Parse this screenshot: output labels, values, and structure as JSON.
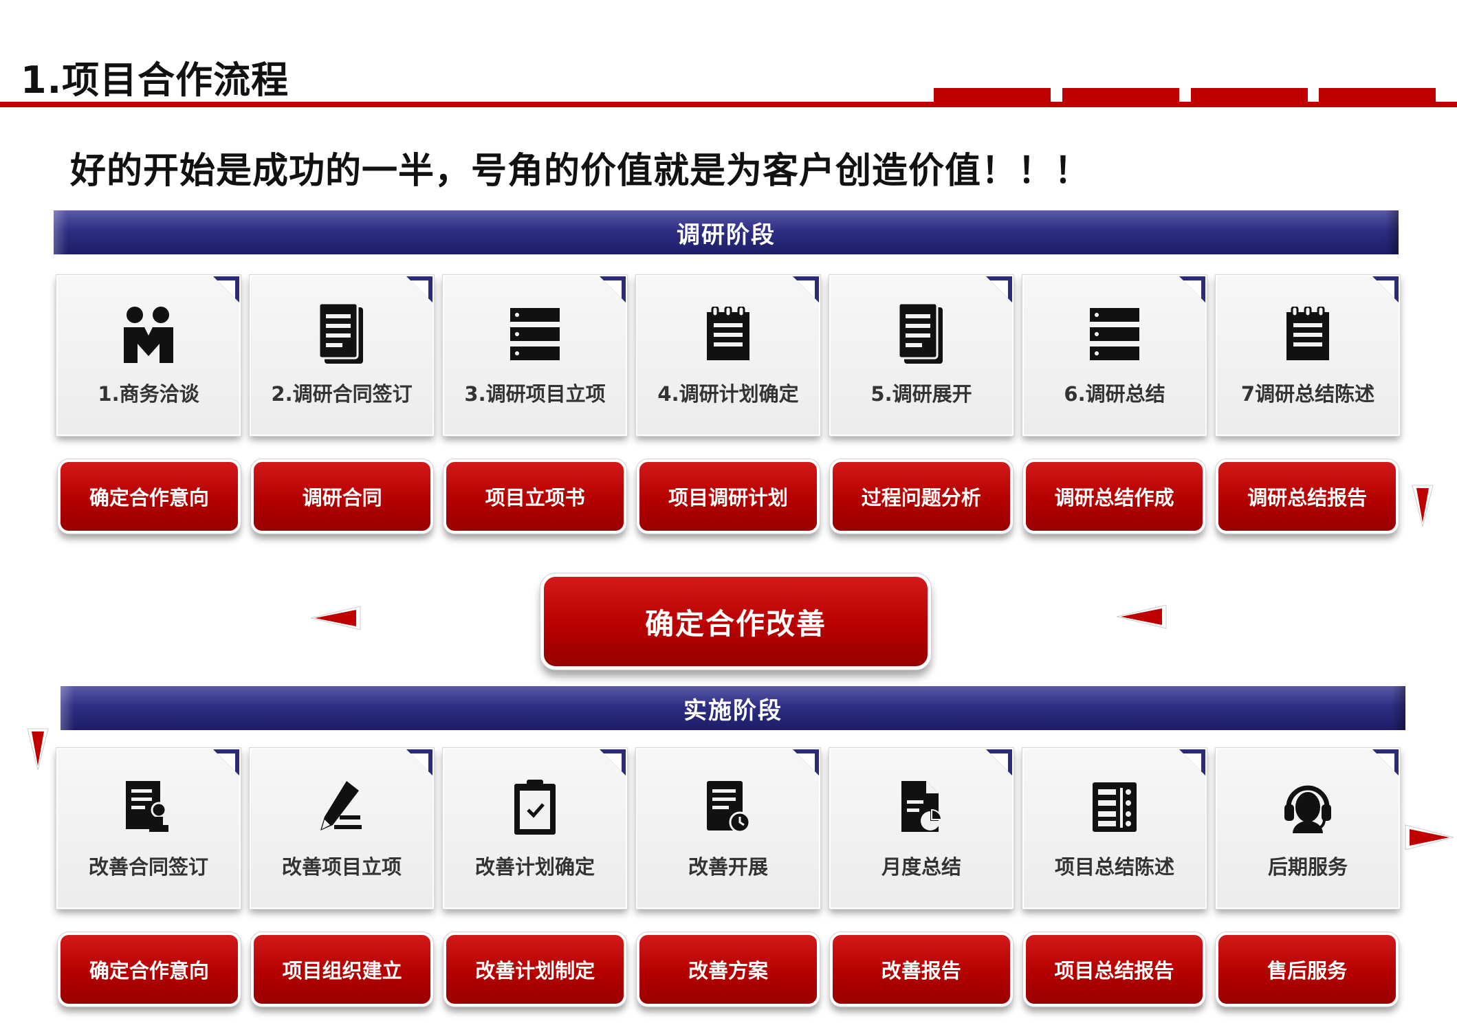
{
  "header": {
    "title": "1.项目合作流程",
    "slogan": "好的开始是成功的一半，号角的价值就是为客户创造价值！！！"
  },
  "colors": {
    "accent_red": "#c00000",
    "stage_navy": "#2e2e84",
    "card_bg": "#f2f2f2"
  },
  "research_stage": {
    "title": "调研阶段",
    "steps": [
      {
        "label": "1.商务洽谈",
        "icon": "handshake-people-icon"
      },
      {
        "label": "2.调研合同签订",
        "icon": "document-icon"
      },
      {
        "label": "3.调研项目立项",
        "icon": "server-list-icon"
      },
      {
        "label": "4.调研计划确定",
        "icon": "notepad-icon"
      },
      {
        "label": "5.调研展开",
        "icon": "document-icon"
      },
      {
        "label": "6.调研总结",
        "icon": "server-list-icon"
      },
      {
        "label": "7调研总结陈述",
        "icon": "notepad-icon"
      }
    ],
    "outputs": [
      "确定合作意向",
      "调研合同",
      "项目立项书",
      "项目调研计划",
      "过程问题分析",
      "调研总结作成",
      "调研总结报告"
    ]
  },
  "transition": {
    "label": "确定合作改善"
  },
  "implementation_stage": {
    "title": "实施阶段",
    "steps": [
      {
        "label": "改善合同签订",
        "icon": "contract-stamp-icon"
      },
      {
        "label": "改善项目立项",
        "icon": "pen-write-icon"
      },
      {
        "label": "改善计划确定",
        "icon": "clipboard-check-icon"
      },
      {
        "label": "改善开展",
        "icon": "document-clock-icon"
      },
      {
        "label": "月度总结",
        "icon": "file-chart-icon"
      },
      {
        "label": "项目总结陈述",
        "icon": "list-grid-icon"
      },
      {
        "label": "后期服务",
        "icon": "headset-support-icon"
      }
    ],
    "outputs": [
      "确定合作意向",
      "项目组织建立",
      "改善计划制定",
      "改善方案",
      "改善报告",
      "项目总结报告",
      "售后服务"
    ]
  }
}
